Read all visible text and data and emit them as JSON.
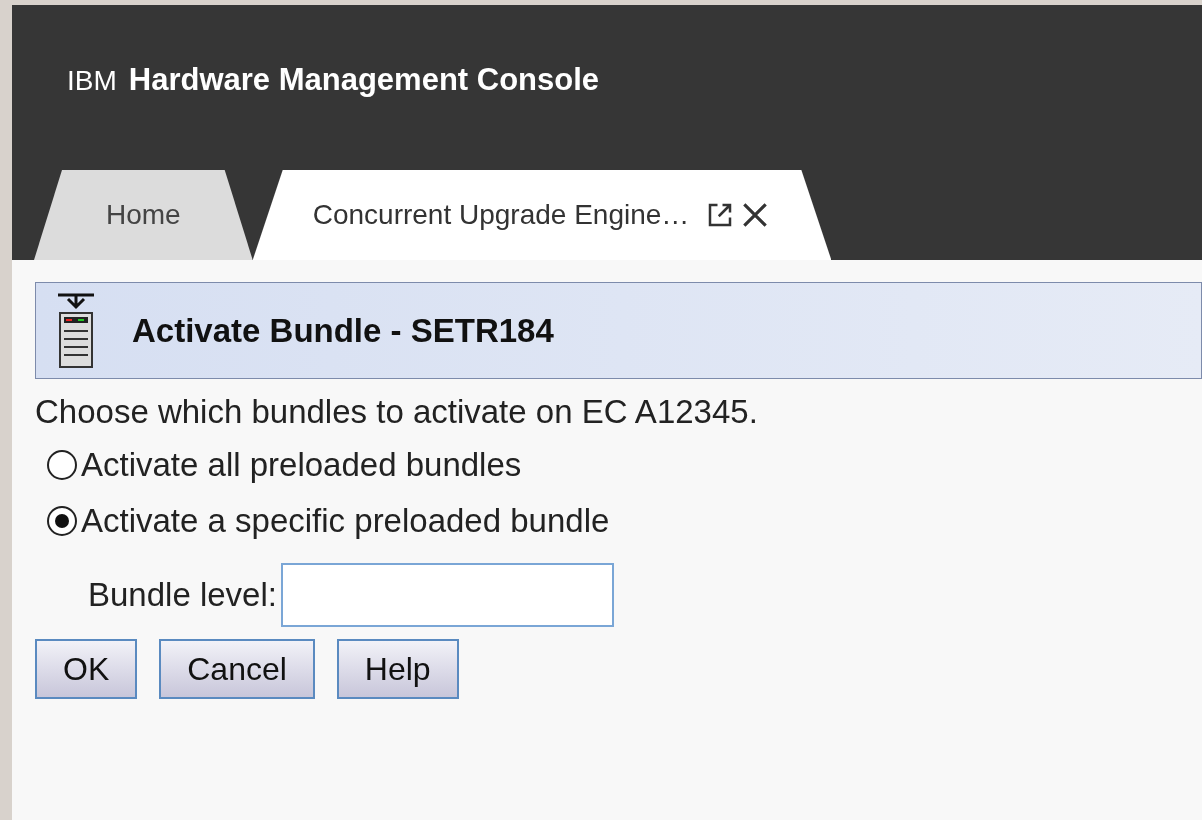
{
  "header": {
    "brand": "IBM",
    "product": "Hardware Management Console"
  },
  "tabs": [
    {
      "label": "Home",
      "selected": false,
      "closable": false
    },
    {
      "label": "Concurrent Upgrade Engine…",
      "selected": true,
      "closable": true
    }
  ],
  "panel": {
    "title": "Activate Bundle - SETR184"
  },
  "instruction": "Choose which bundles to activate on EC A12345.",
  "options": [
    {
      "label": "Activate all preloaded bundles",
      "selected": false
    },
    {
      "label": "Activate a specific preloaded bundle",
      "selected": true
    }
  ],
  "field": {
    "label": "Bundle level:"
  },
  "buttons": [
    "OK",
    "Cancel",
    "Help"
  ]
}
